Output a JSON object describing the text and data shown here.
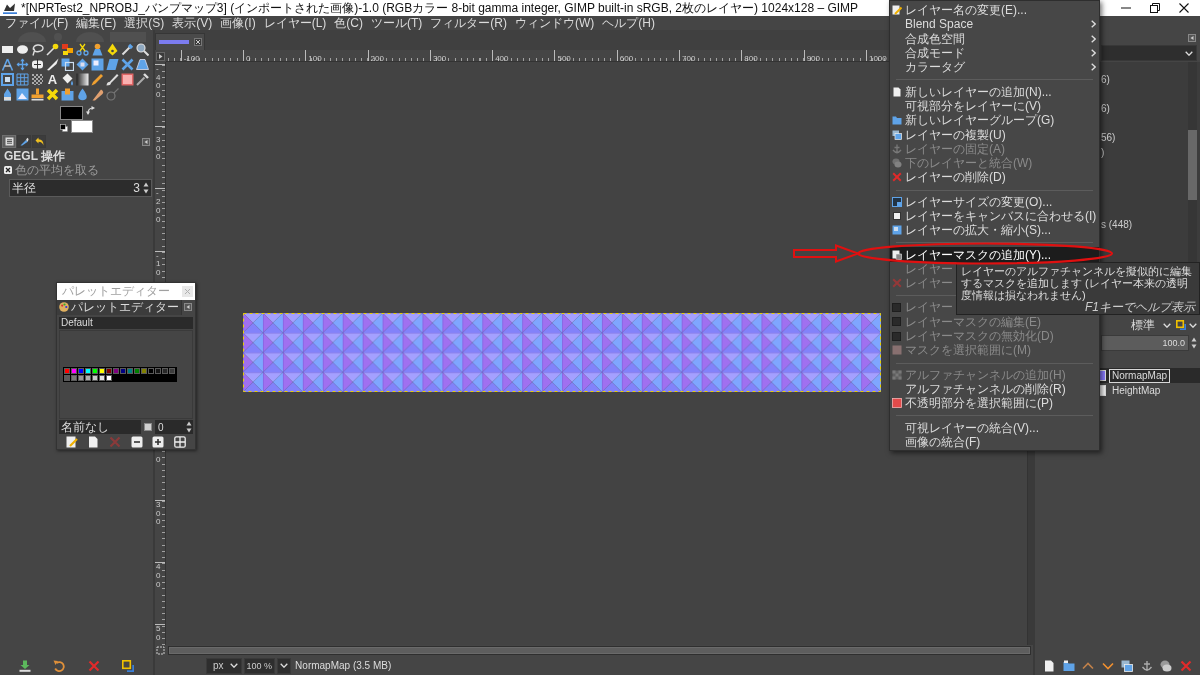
{
  "window": {
    "title": "*[NPRTest2_NPROBJ_バンプマップ3] (インポートされた画像)-1.0 (RGBカラー 8-bit gamma integer, GIMP built-in sRGB, 2枚のレイヤー) 1024x128 – GIMP"
  },
  "menubar": [
    "ファイル(F)",
    "編集(E)",
    "選択(S)",
    "表示(V)",
    "画像(I)",
    "レイヤー(L)",
    "色(C)",
    "ツール(T)",
    "フィルター(R)",
    "ウィンドウ(W)",
    "ヘルプ(H)"
  ],
  "toolbox": {
    "glyph": "A",
    "colors": [
      {
        "kind": "foreground",
        "color": "#000000"
      },
      {
        "kind": "background",
        "color": "#ffffff"
      }
    ]
  },
  "tool_options": {
    "tabs": [
      {
        "kind": "tool-options",
        "selected": true
      },
      {
        "kind": "device-status",
        "selected": false
      },
      {
        "kind": "undo-history",
        "selected": false
      }
    ],
    "title": "GEGL 操作",
    "operation": "色の平均を取る",
    "field": {
      "label": "半径",
      "value": "3"
    }
  },
  "rulers": {
    "horizontal": [
      "-100",
      "0",
      "100",
      "200",
      "300",
      "400",
      "500",
      "600",
      "700",
      "800",
      "900",
      "1000"
    ],
    "vertical": [
      "-400",
      "-300",
      "-200",
      "-10",
      "0",
      "300",
      "400",
      "50"
    ]
  },
  "status_bar": {
    "unit": "px",
    "zoom": "100 %",
    "info": "NormapMap (3.5 MB)"
  },
  "palette_editor": {
    "window_title": "パレットエディター",
    "tab": "パレットエディター",
    "palette": "Default",
    "colors": [
      {
        "color": "#ff0000"
      },
      {
        "color": "#ff00ff"
      },
      {
        "color": "#0000ff"
      },
      {
        "color": "#00ffff"
      },
      {
        "color": "#00ff00"
      },
      {
        "color": "#ffff00"
      },
      {
        "color": "#800000"
      },
      {
        "color": "#800080"
      },
      {
        "color": "#000080"
      },
      {
        "color": "#008080"
      },
      {
        "color": "#008000"
      },
      {
        "color": "#808000"
      },
      {
        "color": "#000000"
      },
      {
        "color": "#141414"
      },
      {
        "color": "#282828"
      },
      {
        "color": "#3c3c3c"
      },
      {
        "color": "#5a5a5a"
      },
      {
        "color": "#787878"
      },
      {
        "color": "#969696"
      },
      {
        "color": "#b0b0b0"
      },
      {
        "color": "#c8c8c8"
      },
      {
        "color": "#e2e2e2"
      },
      {
        "color": "#ffffff"
      }
    ],
    "entry_name": "名前なし",
    "spin_value": "0"
  },
  "layers_dock": {
    "list_fragments": [
      "6)",
      "6)",
      "56)",
      ")",
      "s (448)"
    ],
    "mode": "標準",
    "opacity": {
      "value": "100.0",
      "level": 1
    },
    "layers": [
      {
        "name": "NormapMap",
        "selected": true
      },
      {
        "name": "HeightMap",
        "selected": false
      }
    ]
  },
  "context_menu": {
    "sections": [
      {
        "items": [
          {
            "label": "レイヤー名の変更(E)...",
            "kind": "item",
            "disabled": false,
            "selected": false
          },
          {
            "label": "Blend Space",
            "kind": "submenu",
            "disabled": false,
            "selected": false
          },
          {
            "label": "合成色空間",
            "kind": "submenu",
            "disabled": false,
            "selected": false
          },
          {
            "label": "合成モード",
            "kind": "submenu",
            "disabled": false,
            "selected": false
          },
          {
            "label": "カラータグ",
            "kind": "submenu",
            "disabled": false,
            "selected": false
          }
        ]
      },
      {
        "items": [
          {
            "label": "新しいレイヤーの追加(N)...",
            "kind": "item",
            "disabled": false,
            "selected": false
          },
          {
            "label": "可視部分をレイヤーに(V)",
            "kind": "item",
            "disabled": false,
            "selected": false
          },
          {
            "label": "新しいレイヤーグループ(G)",
            "kind": "item",
            "disabled": false,
            "selected": false
          },
          {
            "label": "レイヤーの複製(U)",
            "kind": "item",
            "disabled": false,
            "selected": false
          },
          {
            "label": "レイヤーの固定(A)",
            "kind": "item",
            "disabled": true,
            "selected": false
          },
          {
            "label": "下のレイヤーと統合(W)",
            "kind": "item",
            "disabled": true,
            "selected": false
          },
          {
            "label": "レイヤーの削除(D)",
            "kind": "item",
            "disabled": false,
            "selected": false
          }
        ]
      },
      {
        "items": [
          {
            "label": "レイヤーサイズの変更(O)...",
            "kind": "item",
            "disabled": false,
            "selected": false
          },
          {
            "label": "レイヤーをキャンバスに合わせる(I)",
            "kind": "item",
            "disabled": false,
            "selected": false
          },
          {
            "label": "レイヤーの拡大・縮小(S)...",
            "kind": "item",
            "disabled": false,
            "selected": false
          }
        ]
      },
      {
        "items": [
          {
            "label": "レイヤーマスクの追加(Y)...",
            "kind": "item",
            "disabled": false,
            "selected": true
          },
          {
            "label": "レイヤー",
            "kind": "item",
            "disabled": true,
            "selected": false
          },
          {
            "label": "レイヤー",
            "kind": "item",
            "disabled": true,
            "selected": false
          }
        ]
      },
      {
        "items": [
          {
            "label": "レイヤー",
            "kind": "check",
            "checked": false,
            "disabled": true,
            "selected": false
          },
          {
            "label": "レイヤーマスクの編集(E)",
            "kind": "check",
            "checked": false,
            "disabled": true,
            "selected": false
          },
          {
            "label": "レイヤーマスクの無効化(D)",
            "kind": "check",
            "checked": false,
            "disabled": true,
            "selected": false
          },
          {
            "label": "マスクを選択範囲に(M)",
            "kind": "item",
            "disabled": true,
            "selected": false
          }
        ]
      },
      {
        "items": [
          {
            "label": "アルファチャンネルの追加(H)",
            "kind": "item",
            "disabled": true,
            "selected": false
          },
          {
            "label": "アルファチャンネルの削除(R)",
            "kind": "item",
            "disabled": false,
            "selected": false
          },
          {
            "label": "不透明部分を選択範囲に(P)",
            "kind": "item",
            "disabled": false,
            "selected": false
          }
        ]
      },
      {
        "items": [
          {
            "label": "可視レイヤーの統合(V)...",
            "kind": "item",
            "disabled": false,
            "selected": false
          },
          {
            "label": "画像の統合(F)",
            "kind": "item",
            "disabled": false,
            "selected": false
          }
        ]
      }
    ]
  },
  "tooltip": {
    "text": "レイヤーのアルファチャンネルを擬似的に編集するマスクを追加します (レイヤー本来の透明度情報は損なわれません)",
    "hint": "F1キーでヘルプ表示"
  }
}
